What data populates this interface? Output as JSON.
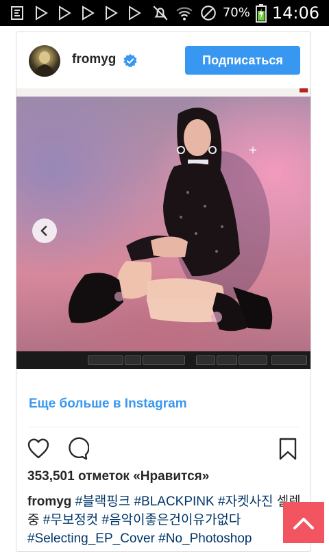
{
  "status_bar": {
    "battery_pct": "70%",
    "time": "14:06",
    "icons": [
      "notification-icon",
      "play-store-icon",
      "play-store-icon",
      "play-store-icon",
      "play-store-icon",
      "play-store-icon",
      "mute-icon",
      "wifi-icon",
      "no-sim-icon",
      "battery-icon"
    ]
  },
  "post": {
    "username": "fromyg",
    "follow_label": "Подписаться",
    "more_link": "Еще больше в Instagram",
    "likes": "353,501 отметок «Нравится»",
    "caption_user": "fromyg",
    "caption_tags": [
      "#블랙핑크",
      "#BLACKPINK",
      "#자켓사진",
      "셀렉중",
      "#무보정컷",
      "#음악이좋은건이유가없다",
      "#Selecting_EP_Cover",
      "#No_Photoshop"
    ]
  },
  "colors": {
    "accent": "#3897f0",
    "fab": "#f2555f",
    "text": "#262626",
    "hashtag": "#003569"
  }
}
